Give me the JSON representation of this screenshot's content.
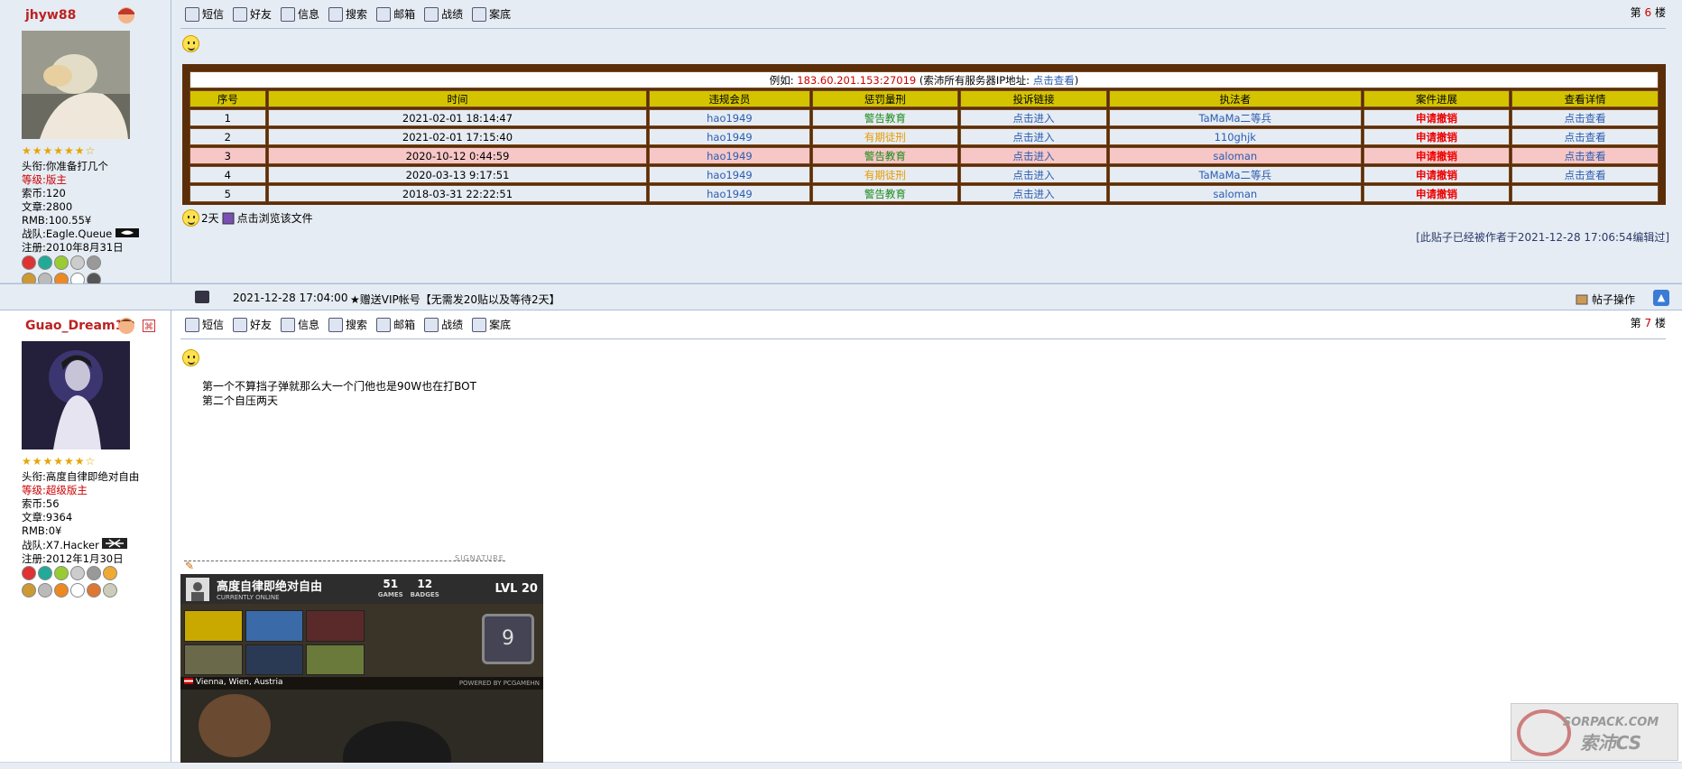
{
  "toolbar": [
    {
      "label": "短信",
      "icon": "message-icon"
    },
    {
      "label": "好友",
      "icon": "friends-icon"
    },
    {
      "label": "信息",
      "icon": "info-icon"
    },
    {
      "label": "搜索",
      "icon": "search-icon"
    },
    {
      "label": "邮箱",
      "icon": "mail-icon"
    },
    {
      "label": "战绩",
      "icon": "stats-icon"
    },
    {
      "label": "案底",
      "icon": "record-icon"
    }
  ],
  "post6": {
    "username": "jhyw88",
    "floor_prefix": "第",
    "floor_num": "6",
    "floor_suffix": "楼",
    "stars": "★★★★★★☆",
    "info": {
      "title_label": "头衔:",
      "title": "你准备打几个",
      "level_label": "等级:",
      "level": "版主",
      "coins_label": "索币:",
      "coins": "120",
      "articles_label": "文章:",
      "articles": "2800",
      "rmb_label": "RMB:",
      "rmb": "100.55¥",
      "team_label": "战队:",
      "team": "Eagle.Queue",
      "reg_label": "注册:",
      "reg": "2010年8月31日"
    },
    "table": {
      "example_prefix": "例如: ",
      "example_ip": "183.60.201.153:27019",
      "example_mid": " (索沛所有服务器IP地址: ",
      "example_link": "点击查看",
      "example_suffix": ")",
      "headers": [
        "序号",
        "时间",
        "违规会员",
        "惩罚量刑",
        "投诉链接",
        "执法者",
        "案件进展",
        "查看详情"
      ],
      "rows": [
        {
          "no": "1",
          "time": "2021-02-01 18:14:47",
          "member": "hao1949",
          "penalty": "警告教育",
          "penalty_type": "green",
          "link": "点击进入",
          "enforcer": "TaMaMa二等兵",
          "progress": "申请撤销",
          "detail": "点击查看",
          "hl": false
        },
        {
          "no": "2",
          "time": "2021-02-01 17:15:40",
          "member": "hao1949",
          "penalty": "有期徒刑",
          "penalty_type": "orange",
          "link": "点击进入",
          "enforcer": "110ghjk",
          "progress": "申请撤销",
          "detail": "点击查看",
          "hl": false
        },
        {
          "no": "3",
          "time": "2020-10-12 0:44:59",
          "member": "hao1949",
          "penalty": "警告教育",
          "penalty_type": "green",
          "link": "点击进入",
          "enforcer": "saloman",
          "progress": "申请撤销",
          "detail": "点击查看",
          "hl": true
        },
        {
          "no": "4",
          "time": "2020-03-13 9:17:51",
          "member": "hao1949",
          "penalty": "有期徒刑",
          "penalty_type": "orange",
          "link": "点击进入",
          "enforcer": "TaMaMa二等兵",
          "progress": "申请撤销",
          "detail": "点击查看",
          "hl": false
        },
        {
          "no": "5",
          "time": "2018-03-31 22:22:51",
          "member": "hao1949",
          "penalty": "警告教育",
          "penalty_type": "green",
          "link": "点击进入",
          "enforcer": "saloman",
          "progress": "申请撤销",
          "detail": "",
          "hl": false
        }
      ]
    },
    "attach_days": "2天",
    "attach_text": "点击浏览该文件",
    "edited": "[此贴子已经被作者于2021-12-28 17:06:54编辑过]"
  },
  "bar": {
    "time": "2021-12-28 17:04:00",
    "vip": "★赠送VIP帐号【无需发20贴以及等待2天】",
    "ops": "帖子操作"
  },
  "post7": {
    "username": "Guao_Dream1r",
    "floor_prefix": "第",
    "floor_num": "7",
    "floor_suffix": "楼",
    "stars": "★★★★★★☆",
    "info": {
      "title_label": "头衔:",
      "title": "高度自律即绝对自由",
      "level_label": "等级:",
      "level": "超级版主",
      "coins_label": "索币:",
      "coins": "56",
      "articles_label": "文章:",
      "articles": "9364",
      "rmb_label": "RMB:",
      "rmb": "0¥",
      "team_label": "战队:",
      "team": "X7.Hacker",
      "reg_label": "注册:",
      "reg": "2012年1月30日"
    },
    "content_line1": "第一个不算挡子弹就那么大一个门他也是90W也在打BOT",
    "content_line2": "第二个自压两天",
    "sig_label": "SIGNATURE",
    "signature": {
      "name": "高度自律即绝对自由",
      "status": "CURRENTLY ONLINE",
      "games": "51",
      "games_label": "GAMES",
      "badges": "12",
      "badges_label": "BADGES",
      "level": "LVL 20",
      "badge_num": "9",
      "location": "Vienna, Wien, Austria",
      "powered": "POWERED BY PCGAMEHN"
    }
  },
  "watermark": "SORPACK.COM 索沛CS"
}
